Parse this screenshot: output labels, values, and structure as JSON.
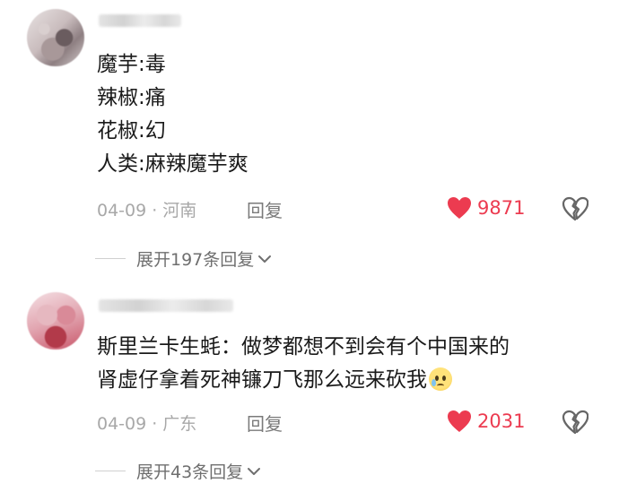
{
  "comments": [
    {
      "content_lines": [
        "魔芋:毒",
        "辣椒:痛",
        "花椒:幻",
        "人类:麻辣魔芋爽"
      ],
      "date": "04-09",
      "dot": "·",
      "location": "河南",
      "reply_label": "回复",
      "likes": "9871",
      "expand_label": "展开197条回复"
    },
    {
      "content_lines": [
        "斯里兰卡生蚝：做梦都想不到会有个中国来的",
        "肾虚仔拿着死神镰刀飞那么远来砍我"
      ],
      "date": "04-09",
      "dot": "·",
      "location": "广东",
      "reply_label": "回复",
      "likes": "2031",
      "expand_label": "展开43条回复"
    }
  ],
  "colors": {
    "like_heart": "#ec3b50",
    "meta_text": "#a8a8a8",
    "body_text": "#1a1a1a"
  },
  "icons": {
    "like": "heart-filled-icon",
    "dislike": "broken-heart-icon",
    "expand": "chevron-down-icon",
    "emoji": "crying-face-emoji"
  }
}
